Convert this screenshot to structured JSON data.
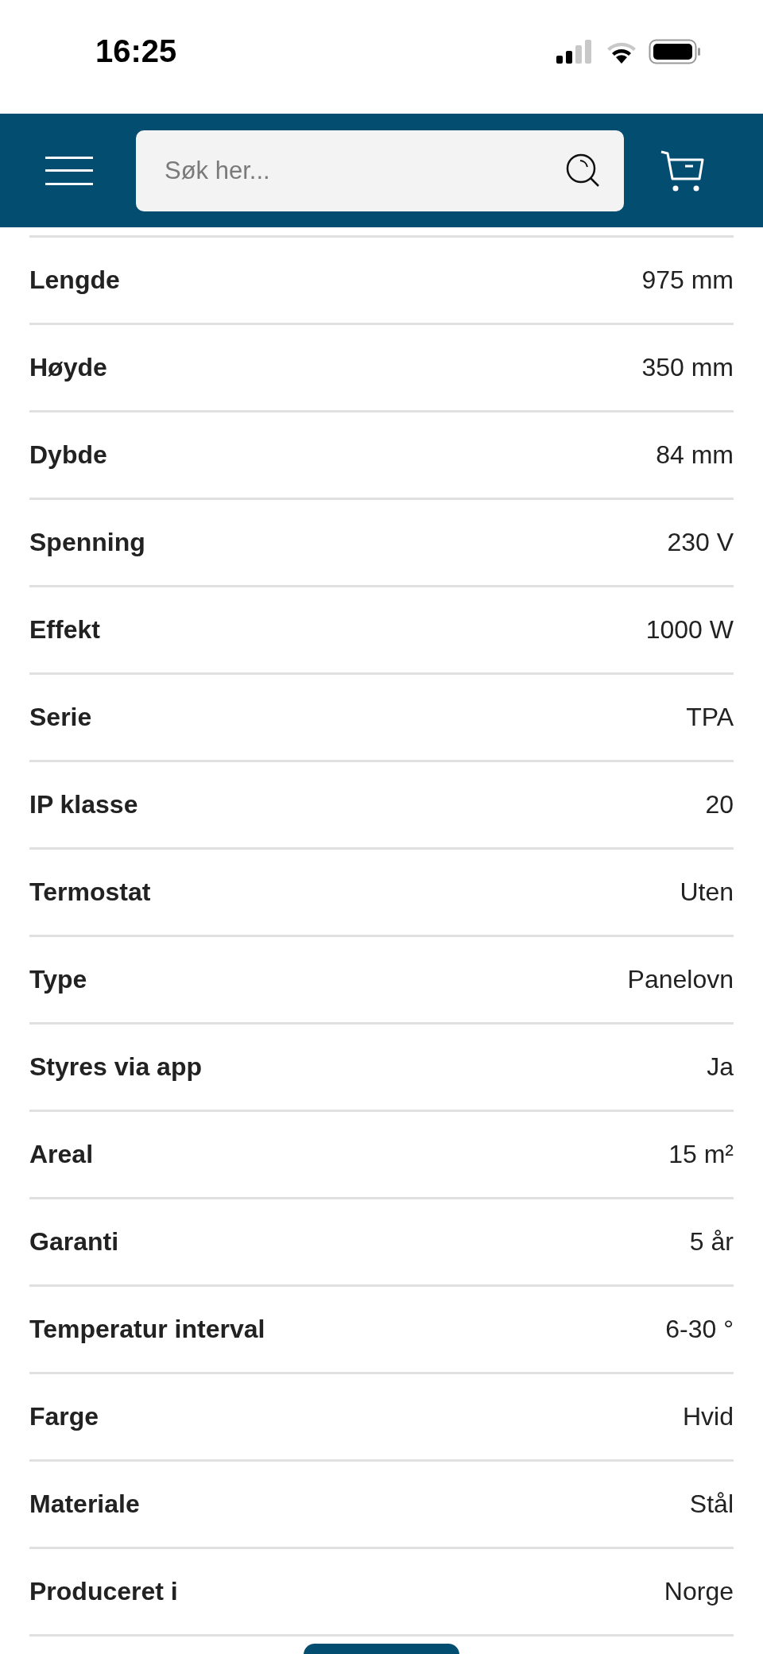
{
  "status_bar": {
    "time": "16:25"
  },
  "header": {
    "search": {
      "placeholder": "Søk her..."
    }
  },
  "specs": [
    {
      "label": "Lengde",
      "value": "975 mm"
    },
    {
      "label": "Høyde",
      "value": "350 mm"
    },
    {
      "label": "Dybde",
      "value": "84 mm"
    },
    {
      "label": "Spenning",
      "value": "230 V"
    },
    {
      "label": "Effekt",
      "value": "1000 W"
    },
    {
      "label": "Serie",
      "value": "TPA"
    },
    {
      "label": "IP klasse",
      "value": "20"
    },
    {
      "label": "Termostat",
      "value": "Uten"
    },
    {
      "label": "Type",
      "value": "Panelovn"
    },
    {
      "label": "Styres via app",
      "value": "Ja"
    },
    {
      "label": "Areal",
      "value": "15 m²"
    },
    {
      "label": "Garanti",
      "value": "5 år"
    },
    {
      "label": "Temperatur interval",
      "value": "6-30 °"
    },
    {
      "label": "Farge",
      "value": "Hvid"
    },
    {
      "label": "Materiale",
      "value": "Stål"
    },
    {
      "label": "Produceret i",
      "value": "Norge"
    }
  ]
}
